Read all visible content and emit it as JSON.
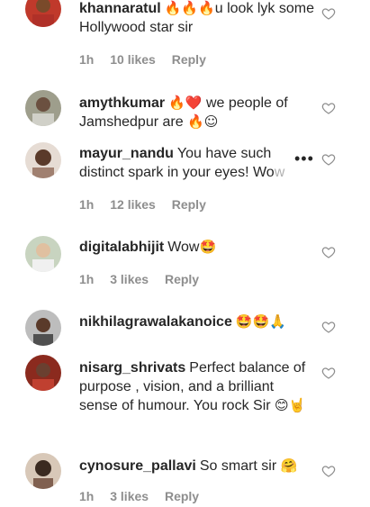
{
  "comments": [
    {
      "username": "khannaratul",
      "text_parts": [
        "🔥🔥🔥",
        "u look lyk some Hollywood star sir"
      ],
      "time": "1h",
      "likes": "10 likes",
      "reply": "Reply"
    },
    {
      "username": "amythkumar",
      "text_parts": [
        "🔥❤️",
        " we people of Jamshedpur are ",
        "🔥☺"
      ]
    },
    {
      "username": "mayur_nandu",
      "text": "You have such distinct spark in your eyes! Wo",
      "text_fade": "w",
      "time": "1h",
      "likes": "12 likes",
      "reply": "Reply"
    },
    {
      "username": "digitalabhijit",
      "text": "Wow",
      "emoji": "🤩",
      "time": "1h",
      "likes": "3 likes",
      "reply": "Reply"
    },
    {
      "username": "nikhilagrawalakanoice",
      "emoji": "🤩🤩🙏"
    },
    {
      "username": "nisarg_shrivats",
      "text": "Perfect balance of purpose , vision, and a brilliant sense of humour. You rock Sir",
      "emoji": "😊🤘"
    },
    {
      "username": "cynosure_pallavi",
      "text": "So smart sir",
      "emoji": "🤗",
      "time": "1h",
      "likes": "3 likes",
      "reply": "Reply"
    }
  ],
  "icons": {
    "like": "heart-outline-icon",
    "more": "more-options-icon"
  },
  "colors": {
    "text": "#262626",
    "meta": "#8e8e8e",
    "background": "#ffffff"
  }
}
